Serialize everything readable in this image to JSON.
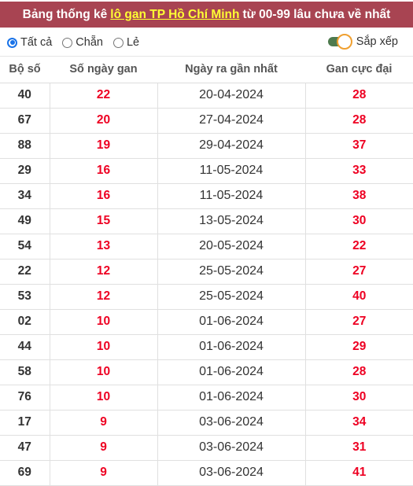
{
  "title": {
    "prefix": "Bảng thống kê",
    "highlight": "lô gan TP Hồ Chí Minh",
    "suffix": "từ 00-99 lâu chưa về nhất"
  },
  "filters": {
    "options": [
      {
        "label": "Tất cả",
        "checked": true
      },
      {
        "label": "Chẵn",
        "checked": false
      },
      {
        "label": "Lẻ",
        "checked": false
      }
    ],
    "sort_label": "Sắp xếp",
    "sort_enabled": true
  },
  "colors": {
    "title_bg": "#a84452",
    "highlight": "#ffff33",
    "red_value": "#ee0022",
    "radio_accent": "#1a73e8",
    "toggle_track": "#4e7a4e",
    "toggle_knob_border": "#f0a030"
  },
  "table": {
    "headers": [
      "Bộ số",
      "Số ngày gan",
      "Ngày ra gần nhất",
      "Gan cực đại"
    ],
    "rows": [
      {
        "number": "40",
        "days": "22",
        "last_date": "20-04-2024",
        "max_gan": "28"
      },
      {
        "number": "67",
        "days": "20",
        "last_date": "27-04-2024",
        "max_gan": "28"
      },
      {
        "number": "88",
        "days": "19",
        "last_date": "29-04-2024",
        "max_gan": "37"
      },
      {
        "number": "29",
        "days": "16",
        "last_date": "11-05-2024",
        "max_gan": "33"
      },
      {
        "number": "34",
        "days": "16",
        "last_date": "11-05-2024",
        "max_gan": "38"
      },
      {
        "number": "49",
        "days": "15",
        "last_date": "13-05-2024",
        "max_gan": "30"
      },
      {
        "number": "54",
        "days": "13",
        "last_date": "20-05-2024",
        "max_gan": "22"
      },
      {
        "number": "22",
        "days": "12",
        "last_date": "25-05-2024",
        "max_gan": "27"
      },
      {
        "number": "53",
        "days": "12",
        "last_date": "25-05-2024",
        "max_gan": "40"
      },
      {
        "number": "02",
        "days": "10",
        "last_date": "01-06-2024",
        "max_gan": "27"
      },
      {
        "number": "44",
        "days": "10",
        "last_date": "01-06-2024",
        "max_gan": "29"
      },
      {
        "number": "58",
        "days": "10",
        "last_date": "01-06-2024",
        "max_gan": "28"
      },
      {
        "number": "76",
        "days": "10",
        "last_date": "01-06-2024",
        "max_gan": "30"
      },
      {
        "number": "17",
        "days": "9",
        "last_date": "03-06-2024",
        "max_gan": "34"
      },
      {
        "number": "47",
        "days": "9",
        "last_date": "03-06-2024",
        "max_gan": "31"
      },
      {
        "number": "69",
        "days": "9",
        "last_date": "03-06-2024",
        "max_gan": "41"
      }
    ]
  }
}
